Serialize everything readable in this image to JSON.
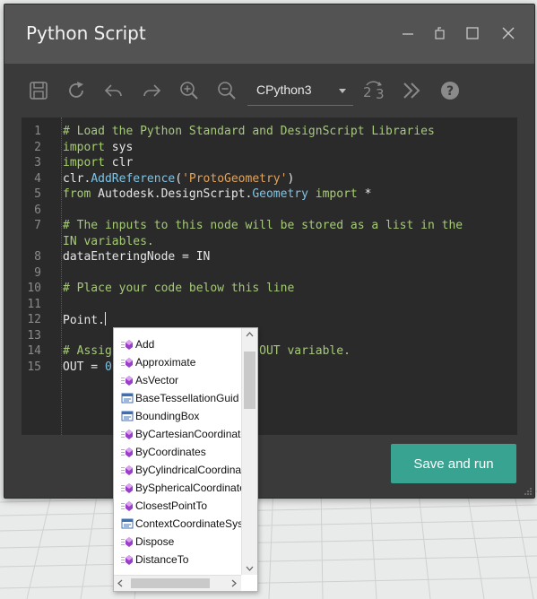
{
  "window": {
    "title": "Python Script"
  },
  "toolbar": {
    "engine_selected": "CPython3",
    "buttons": [
      "save-icon",
      "reset-icon",
      "undo-icon",
      "redo-icon",
      "zoom-in-icon",
      "zoom-out-icon",
      "convert-icon",
      "more-icon",
      "help-icon"
    ]
  },
  "editor": {
    "line_numbers": [
      "1",
      "2",
      "3",
      "4",
      "5",
      "6",
      "7",
      "",
      "8",
      "9",
      "10",
      "11",
      "12",
      "13",
      "14",
      "15"
    ],
    "lines": {
      "l1": "# Load the Python Standard and DesignScript Libraries",
      "l2a": "import",
      "l2b": " sys",
      "l3a": "import",
      "l3b": " clr",
      "l4a": "clr.",
      "l4b": "AddReference",
      "l4c": "(",
      "l4d": "'ProtoGeometry'",
      "l4e": ")",
      "l5a": "from",
      "l5b": " Autodesk.DesignScript.",
      "l5c": "Geometry",
      "l5d": " import",
      "l5e": " *",
      "l7": "# The inputs to this node will be stored as a list in the",
      "l7b": "IN variables.",
      "l8": "dataEnteringNode = IN",
      "l10": "# Place your code below this line",
      "l12": "Point.",
      "l14": "# Assign your output to the OUT variable.",
      "l15a": "OUT = ",
      "l15b": "0"
    }
  },
  "run_button": {
    "label": "Save and run"
  },
  "autocomplete": {
    "items": [
      {
        "label": "Add",
        "kind": "method"
      },
      {
        "label": "Approximate",
        "kind": "method"
      },
      {
        "label": "AsVector",
        "kind": "method"
      },
      {
        "label": "BaseTessellationGuid",
        "kind": "property"
      },
      {
        "label": "BoundingBox",
        "kind": "property"
      },
      {
        "label": "ByCartesianCoordinates",
        "kind": "method"
      },
      {
        "label": "ByCoordinates",
        "kind": "method"
      },
      {
        "label": "ByCylindricalCoordinates",
        "kind": "method"
      },
      {
        "label": "BySphericalCoordinates",
        "kind": "method"
      },
      {
        "label": "ClosestPointTo",
        "kind": "method"
      },
      {
        "label": "ContextCoordinateSystem",
        "kind": "property"
      },
      {
        "label": "Dispose",
        "kind": "method"
      },
      {
        "label": "DistanceTo",
        "kind": "method"
      }
    ]
  },
  "colors": {
    "accent": "#38a391",
    "titlebar": "#535353",
    "editor_bg": "#2a2a2a"
  }
}
